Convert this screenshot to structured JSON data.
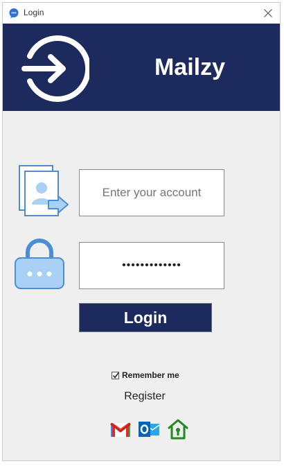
{
  "window": {
    "title": "Login",
    "icon": "chat-bubble-icon",
    "close_icon": "close-icon"
  },
  "header": {
    "app_name": "Mailzy",
    "icon": "login-arrow-circle-icon",
    "background": "#1d2a5e"
  },
  "form": {
    "account_icon": "account-transfer-icon",
    "account_placeholder": "Enter your account",
    "account_value": "",
    "password_icon": "lock-icon",
    "password_value": "•••••••••••••",
    "login_label": "Login",
    "remember_label": "Remember me",
    "remember_checked": true,
    "register_label": "Register"
  },
  "providers": [
    {
      "name": "gmail",
      "icon": "gmail-icon"
    },
    {
      "name": "outlook",
      "icon": "outlook-icon"
    },
    {
      "name": "home",
      "icon": "home-icon"
    }
  ],
  "colors": {
    "accent": "#1d2a5e",
    "icon_blue": "#4a8ed6",
    "icon_light_blue": "#a9d0f5"
  }
}
